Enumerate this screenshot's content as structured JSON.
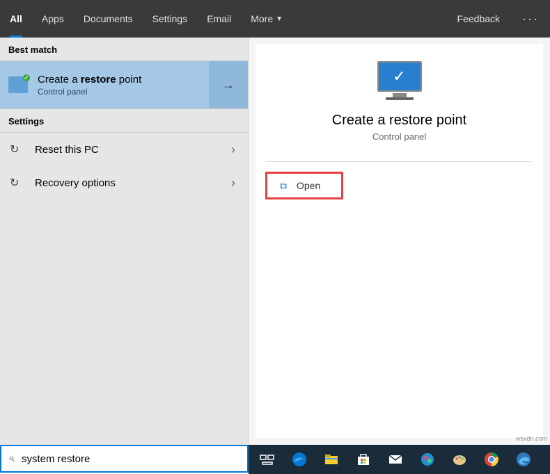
{
  "topbar": {
    "tabs": [
      {
        "label": "All",
        "active": true
      },
      {
        "label": "Apps"
      },
      {
        "label": "Documents"
      },
      {
        "label": "Settings"
      },
      {
        "label": "Email"
      },
      {
        "label": "More",
        "dropdown": true
      }
    ],
    "feedback": "Feedback"
  },
  "sections": {
    "best_match_header": "Best match",
    "settings_header": "Settings"
  },
  "best_match": {
    "title_pre": "Create a ",
    "title_bold": "restore",
    "title_post": " point",
    "subtitle": "Control panel"
  },
  "settings_items": [
    {
      "label": "Reset this PC"
    },
    {
      "label": "Recovery options"
    }
  ],
  "detail": {
    "title": "Create a restore point",
    "subtitle": "Control panel",
    "open_label": "Open"
  },
  "search": {
    "value": "system restore"
  },
  "watermark": "wsxdn.com",
  "taskbar_icons": [
    "task-view",
    "edge",
    "file-explorer",
    "microsoft-store",
    "mail",
    "photos",
    "paint",
    "chrome",
    "legacy-edge"
  ]
}
